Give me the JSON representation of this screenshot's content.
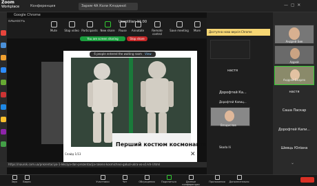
{
  "topbar": {
    "brand_line1": "Zoom",
    "brand_line2": "Workplace",
    "tab_conference": "Конференция",
    "tab_active": "Зарем 4А Коли Клэдиноt"
  },
  "chrome": {
    "label": "Google Chrome",
    "shortlabel": "ольность"
  },
  "zoom_toolbar": {
    "timer": "Ucaptilian 11:00",
    "buttons": [
      "Mute",
      "Stop video",
      "Participants",
      "New share",
      "Pause",
      "Annotate",
      "Remote control",
      "Save meeting",
      "More"
    ]
  },
  "sharing": {
    "pill": "You are screen sharing",
    "stop": "Stop share",
    "waiting": "6 people entered the waiting room",
    "view": "View"
  },
  "photo": {
    "caption": "Перший костюм космонавта",
    "zoom": "Слайд 1/13",
    "close": "✕"
  },
  "url": "https://naurok.com.ua/prezentaciya-1-lekciya-dan-prezentacija-rakens-kosmichnoi-galuzi-ukra-vo-x1-kh-l.html",
  "banner": "Доступна нова версія Chrome",
  "middle_participants": [
    {
      "name": "настя"
    },
    {
      "name": "Дорофтей Ка..."
    },
    {
      "name": "Дорофтей Капиц..."
    },
    {
      "name": "Владислав"
    },
    {
      "name": "Skoda Ili"
    }
  ],
  "right_participants": [
    {
      "name": "Андрей Бик"
    },
    {
      "name": "Адрей"
    },
    {
      "name": "Андрей Бкарло"
    },
    {
      "name": "настя"
    },
    {
      "name": "Саша Паскар"
    },
    {
      "name": "Дорофтей Капи..."
    },
    {
      "name": "Шевць Юліана"
    }
  ],
  "bottom_toolbar": {
    "buttons": [
      "Звук",
      "Видео",
      "Участники",
      "Чат",
      "Обсуждения",
      "Поделиться",
      "Данные конференции",
      "Приложения",
      "Дополнительно"
    ]
  },
  "colors": {
    "share_green": "#1b9e3e",
    "stop_red": "#c62828",
    "banner_yellow": "#f7d774"
  }
}
